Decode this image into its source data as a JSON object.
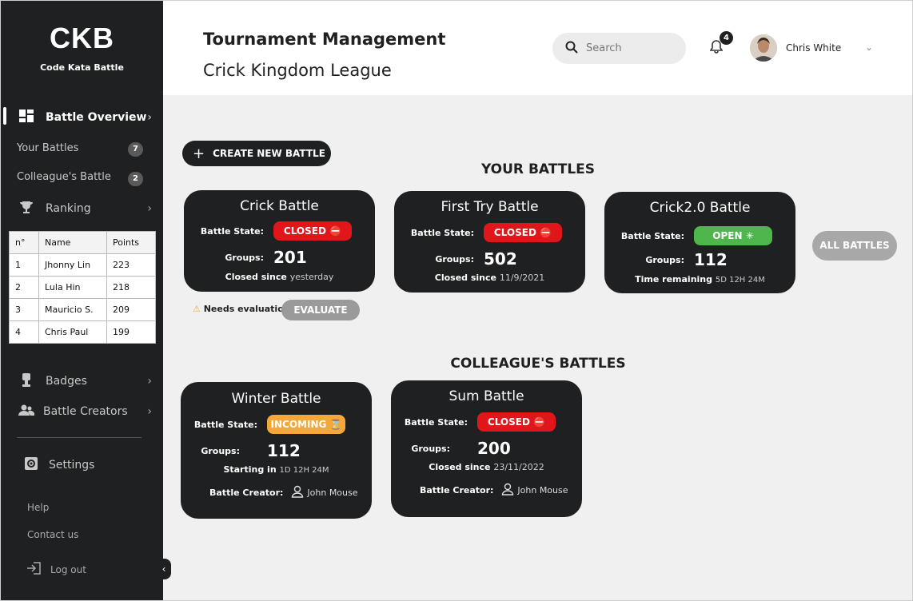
{
  "brand": {
    "logo": "CKB",
    "tagline": "Code Kata Battle"
  },
  "sidebar": {
    "battle_overview": "Battle Overview",
    "your_battles": {
      "label": "Your Battles",
      "count": "7"
    },
    "colleagues_battle": {
      "label": "Colleague's Battle",
      "count": "2"
    },
    "ranking": "Ranking",
    "ranking_table": {
      "headers": [
        "n°",
        "Name",
        "Points"
      ],
      "rows": [
        [
          "1",
          "Jhonny Lin",
          "223"
        ],
        [
          "2",
          "Lula Hin",
          "218"
        ],
        [
          "3",
          "Mauricio S.",
          "209"
        ],
        [
          "4",
          "Chris Paul",
          "199"
        ]
      ]
    },
    "badges": "Badges",
    "battle_creators": "Battle Creators",
    "settings": "Settings",
    "help": "Help",
    "contact": "Contact us",
    "logout": "Log out"
  },
  "header": {
    "title": "Tournament Management",
    "subtitle": "Crick Kingdom League",
    "search_placeholder": "Search",
    "notifications": "4",
    "user_name": "Chris White"
  },
  "main": {
    "create_button": "CREATE NEW BATTLE",
    "your_battles_title": "YOUR BATTLES",
    "colleagues_title": "COLLEAGUE'S BATTLES",
    "all_battles_button": "ALL BATTLES",
    "needs_evaluation": "Needs evaluation",
    "evaluate_button": "EVALUATE",
    "state_label": "Battle State:",
    "groups_label": "Groups:",
    "creator_label": "Battle Creator:",
    "your_cards": [
      {
        "title": "Crick Battle",
        "state": "CLOSED",
        "state_icon": "⛔",
        "groups": "201",
        "foot_label": "Closed since",
        "foot_value": "yesterday"
      },
      {
        "title": "First Try Battle",
        "state": "CLOSED",
        "state_icon": "⛔",
        "groups": "502",
        "foot_label": "Closed since",
        "foot_value": "11/9/2021"
      },
      {
        "title": "Crick2.0 Battle",
        "state": "OPEN",
        "state_icon": "✳",
        "groups": "112",
        "foot_label": "Time remaining",
        "foot_value": "5D 12H 24M"
      }
    ],
    "colleague_cards": [
      {
        "title": "Winter Battle",
        "state": "INCOMING",
        "state_icon": "⌛",
        "groups": "112",
        "foot_label": "Starting in",
        "foot_value": "1D 12H 24M",
        "creator": "John Mouse"
      },
      {
        "title": "Sum Battle",
        "state": "CLOSED",
        "state_icon": "⛔",
        "groups": "200",
        "foot_label": "Closed since",
        "foot_value": "23/11/2022",
        "creator": "John Mouse"
      }
    ]
  },
  "colors": {
    "dark": "#1f2021",
    "closed": "#e0161b",
    "open": "#4fb54d",
    "incoming": "#f5a83a",
    "background": "#f0f0f0"
  }
}
